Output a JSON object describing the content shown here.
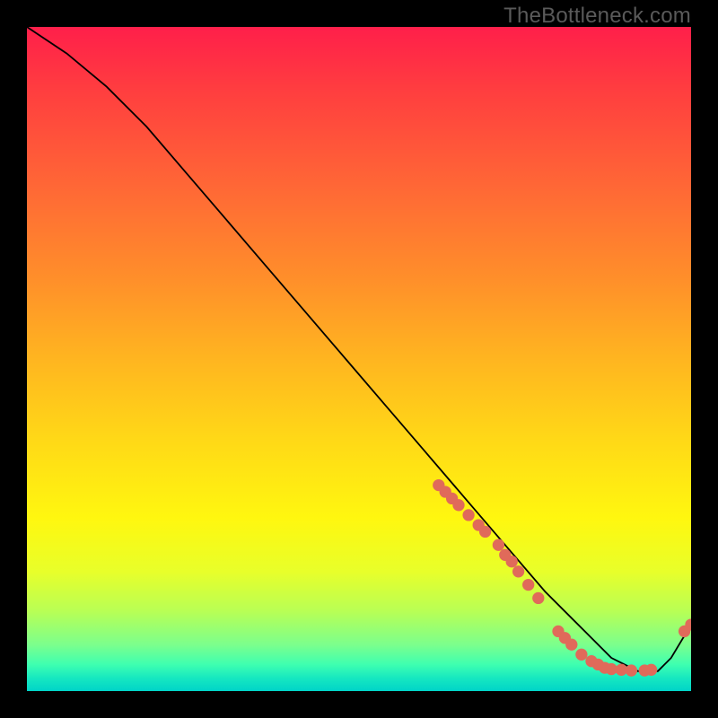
{
  "watermark": "TheBottleneck.com",
  "chart_data": {
    "type": "line",
    "title": "",
    "xlabel": "",
    "ylabel": "",
    "xlim": [
      0,
      100
    ],
    "ylim": [
      0,
      100
    ],
    "grid": false,
    "legend": false,
    "series": [
      {
        "name": "curve",
        "color": "#000000",
        "x": [
          0,
          6,
          12,
          18,
          24,
          30,
          36,
          42,
          48,
          54,
          60,
          66,
          72,
          78,
          84,
          88,
          92,
          95,
          97,
          100
        ],
        "y": [
          100,
          96,
          91,
          85,
          78,
          71,
          64,
          57,
          50,
          43,
          36,
          29,
          22,
          15,
          9,
          5,
          3,
          3,
          5,
          10
        ]
      }
    ],
    "markers": [
      {
        "name": "dots",
        "color": "#e06a5a",
        "points": [
          {
            "x": 62,
            "y": 31
          },
          {
            "x": 63,
            "y": 30
          },
          {
            "x": 64,
            "y": 29
          },
          {
            "x": 65,
            "y": 28
          },
          {
            "x": 66.5,
            "y": 26.5
          },
          {
            "x": 68,
            "y": 25
          },
          {
            "x": 69,
            "y": 24
          },
          {
            "x": 71,
            "y": 22
          },
          {
            "x": 72,
            "y": 20.5
          },
          {
            "x": 73,
            "y": 19.5
          },
          {
            "x": 74,
            "y": 18
          },
          {
            "x": 75.5,
            "y": 16
          },
          {
            "x": 77,
            "y": 14
          },
          {
            "x": 80,
            "y": 9
          },
          {
            "x": 81,
            "y": 8
          },
          {
            "x": 82,
            "y": 7
          },
          {
            "x": 83.5,
            "y": 5.5
          },
          {
            "x": 85,
            "y": 4.5
          },
          {
            "x": 86,
            "y": 4
          },
          {
            "x": 87,
            "y": 3.5
          },
          {
            "x": 88,
            "y": 3.3
          },
          {
            "x": 89.5,
            "y": 3.2
          },
          {
            "x": 91,
            "y": 3.1
          },
          {
            "x": 93,
            "y": 3.1
          },
          {
            "x": 94,
            "y": 3.2
          },
          {
            "x": 99,
            "y": 9
          },
          {
            "x": 100,
            "y": 10
          }
        ]
      }
    ]
  }
}
